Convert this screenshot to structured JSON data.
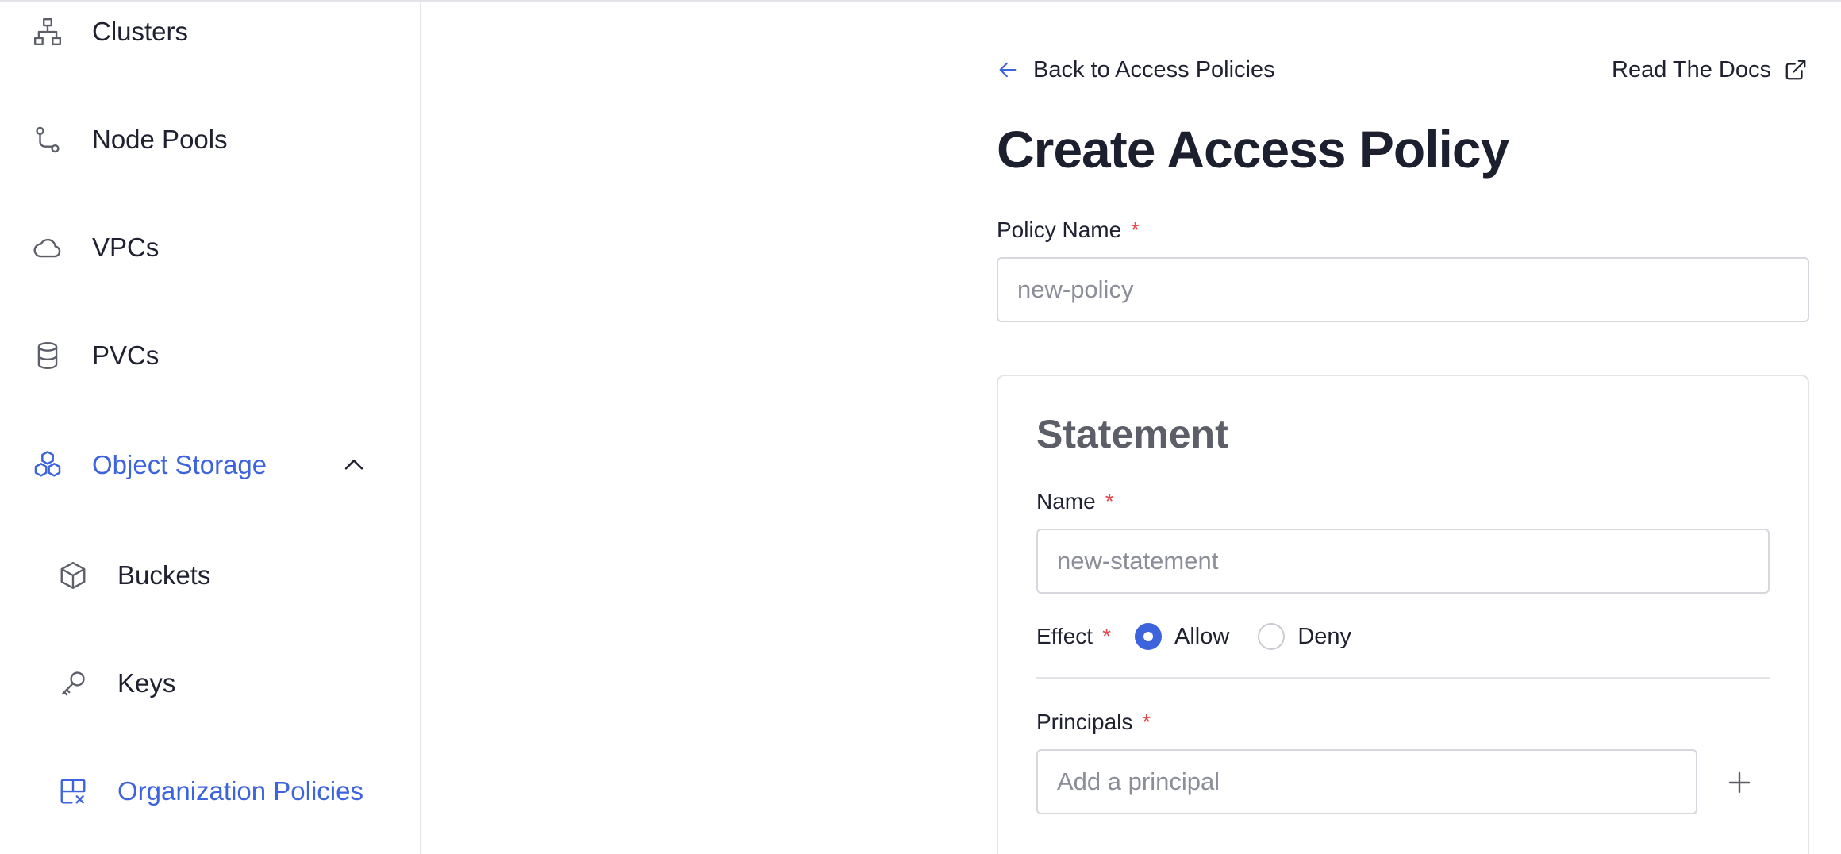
{
  "sidebar": {
    "items": [
      {
        "label": "Clusters",
        "icon": "clusters-icon"
      },
      {
        "label": "Node Pools",
        "icon": "node-pools-icon"
      },
      {
        "label": "VPCs",
        "icon": "cloud-icon"
      },
      {
        "label": "PVCs",
        "icon": "database-icon"
      },
      {
        "label": "Object Storage",
        "icon": "object-storage-icon",
        "expanded": true,
        "active": true
      },
      {
        "label": "Buckets",
        "icon": "cube-icon"
      },
      {
        "label": "Keys",
        "icon": "key-icon"
      },
      {
        "label": "Organization Policies",
        "icon": "policy-grid-icon",
        "active": true
      }
    ]
  },
  "header": {
    "back_label": "Back to Access Policies",
    "docs_label": "Read The Docs"
  },
  "page": {
    "title": "Create Access Policy"
  },
  "form": {
    "policy_name": {
      "label": "Policy Name",
      "required_mark": "*",
      "value": "",
      "placeholder": "new-policy"
    },
    "statement": {
      "title": "Statement",
      "name": {
        "label": "Name",
        "required_mark": "*",
        "value": "",
        "placeholder": "new-statement"
      },
      "effect": {
        "label": "Effect",
        "required_mark": "*",
        "options": [
          "Allow",
          "Deny"
        ],
        "selected": "Allow"
      },
      "principals": {
        "label": "Principals",
        "required_mark": "*",
        "value": "",
        "placeholder": "Add a principal"
      }
    }
  },
  "colors": {
    "accent": "#3d63dd",
    "required": "#e5484d",
    "text": "#1f2130",
    "border": "#d6d8de"
  }
}
